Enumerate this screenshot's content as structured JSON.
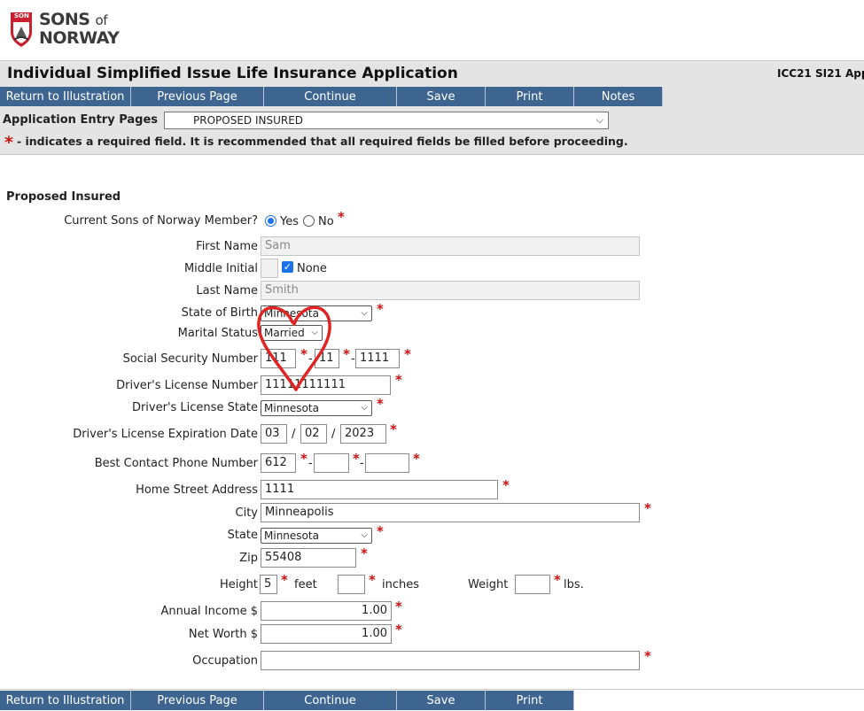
{
  "brand": {
    "line1": "SONS",
    "of": "of",
    "line2": "NORWAY",
    "badge_text": "SON"
  },
  "header": {
    "title": "Individual Simplified Issue Life Insurance Application",
    "form_code": "ICC21 SI21 App"
  },
  "toolbar": {
    "return": "Return to Illustration",
    "previous": "Previous Page",
    "continue": "Continue",
    "save": "Save",
    "print": "Print",
    "notes": "Notes"
  },
  "entry_pages": {
    "label": "Application Entry Pages",
    "selected": "PROPOSED INSURED"
  },
  "required_note": "- indicates a required field. It is recommended that all required fields be filled before proceeding.",
  "required_marker": "*",
  "section_title": "Proposed Insured",
  "form": {
    "member_label": "Current Sons of Norway Member?",
    "member_yes": "Yes",
    "member_no": "No",
    "member_value": "Yes",
    "first_name_label": "First Name",
    "first_name": "Sam",
    "middle_initial_label": "Middle Initial",
    "middle_initial": "",
    "none_label": "None",
    "none_checked": true,
    "last_name_label": "Last Name",
    "last_name": "Smith",
    "state_birth_label": "State of Birth",
    "state_birth": "Minnesota",
    "marital_label": "Marital Status",
    "marital": "Married",
    "ssn_label": "Social Security Number",
    "ssn": [
      "111",
      "11",
      "1111"
    ],
    "dl_number_label": "Driver's License Number",
    "dl_number": "11111111111",
    "dl_state_label": "Driver's License State",
    "dl_state": "Minnesota",
    "dl_exp_label": "Driver's License Expiration Date",
    "dl_exp": [
      "03",
      "02",
      "2023"
    ],
    "phone_label": "Best Contact Phone Number",
    "phone": [
      "612",
      "",
      ""
    ],
    "street_label": "Home Street Address",
    "street": "1111",
    "city_label": "City",
    "city": "Minneapolis",
    "state_label": "State",
    "state": "Minnesota",
    "zip_label": "Zip",
    "zip": "55408",
    "height_label": "Height",
    "height_feet": "5",
    "feet_label": "feet",
    "height_inches": "",
    "inches_label": "inches",
    "weight_label": "Weight",
    "weight": "",
    "lbs_label": "lbs.",
    "income_label": "Annual Income $",
    "income": "1.00",
    "networth_label": "Net Worth $",
    "networth": "1.00",
    "occupation_label": "Occupation",
    "occupation": ""
  },
  "colors": {
    "toolbar_bg": "#3d6590",
    "band_bg": "#e4e4e4",
    "required_star": "#cc1111",
    "heart_annotation": "#e02424",
    "brand_red": "#c8202f"
  },
  "icons": {
    "logo": "sons-of-norway-shield-logo",
    "dropdown": "chevron-down-icon",
    "annotation": "hand-drawn-heart"
  }
}
